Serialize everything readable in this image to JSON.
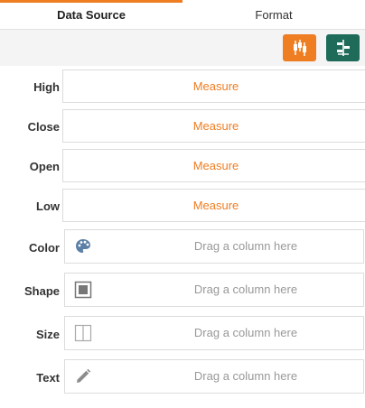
{
  "tabs": {
    "data_source": "Data Source",
    "format": "Format"
  },
  "toolbar": {
    "buttons": [
      {
        "icon": "candlestick-chart-icon",
        "color": "#ef7d22"
      },
      {
        "icon": "chart-settings-icon",
        "color": "#1f6b5a"
      }
    ]
  },
  "measures": [
    {
      "label": "High",
      "value": "Measure"
    },
    {
      "label": "Close",
      "value": "Measure"
    },
    {
      "label": "Open",
      "value": "Measure"
    },
    {
      "label": "Low",
      "value": "Measure"
    }
  ],
  "encodings": [
    {
      "label": "Color",
      "placeholder": "Drag a column here",
      "icon": "palette-icon"
    },
    {
      "label": "Shape",
      "placeholder": "Drag a column here",
      "icon": "shape-icon"
    },
    {
      "label": "Size",
      "placeholder": "Drag a column here",
      "icon": "size-icon"
    },
    {
      "label": "Text",
      "placeholder": "Drag a column here",
      "icon": "pencil-icon"
    }
  ],
  "colors": {
    "accent": "#ef7d22",
    "secondary": "#1f6b5a"
  }
}
